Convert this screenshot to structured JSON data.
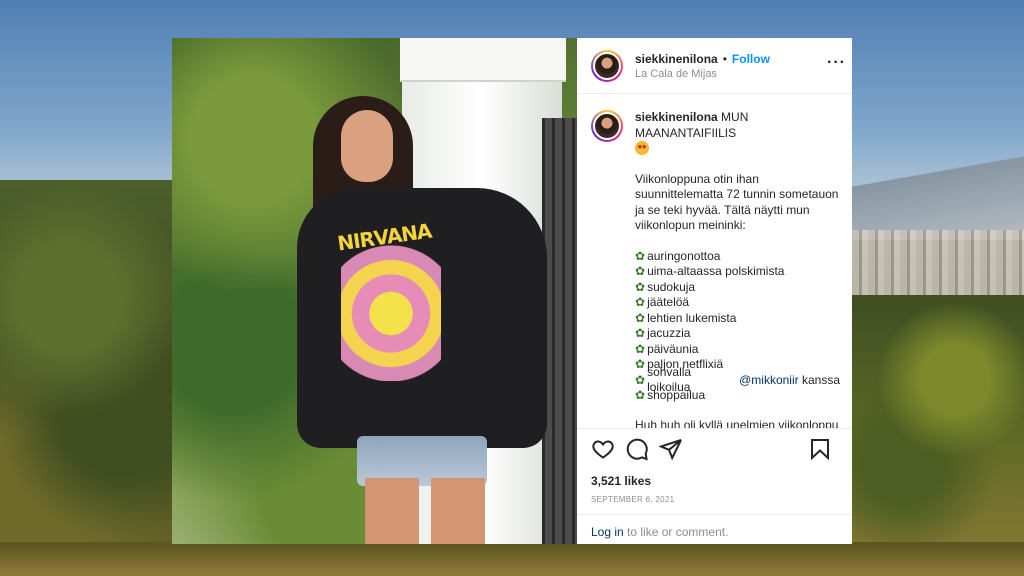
{
  "post": {
    "username": "siekkinenilona",
    "follow_label": "Follow",
    "location": "La Cala de Mijas",
    "caption": {
      "title": "MUN MAANANTAIFIILIS",
      "paragraph": "Viikonloppuna otin ihan suunnittelematta 72 tunnin sometauon ja se teki hyvää. Tältä näytti mun viikonlopun meininki:",
      "list": [
        "auringonottoa",
        "uima-altaassa polskimista",
        "sudokuja",
        "jäätelöä",
        "lehtien lukemista",
        "jacuzzia",
        "päiväunia",
        "paljon netflixiä",
        "sohvalla loikoilua",
        "shoppailua"
      ],
      "mention": "@mikkoniir",
      "mention_suffix": "kanssa",
      "closing": "Huh huh oli kyllä unelmien viikonloppu"
    },
    "photo_text": "NIRVANA",
    "likes": "3,521 likes",
    "date": "SEPTEMBER 6, 2021",
    "login_link": "Log in",
    "login_suffix": "to like or comment."
  },
  "icons": {
    "heart": "heart-icon",
    "comment": "comment-icon",
    "share": "share-icon",
    "save": "bookmark-icon",
    "more": "more-icon",
    "list_bullet": "flower-icon",
    "emoji": "star-struck-emoji"
  },
  "colors": {
    "follow": "#0095f6",
    "mention": "#00376b",
    "muted": "#8e8e8e",
    "text": "#262626"
  }
}
